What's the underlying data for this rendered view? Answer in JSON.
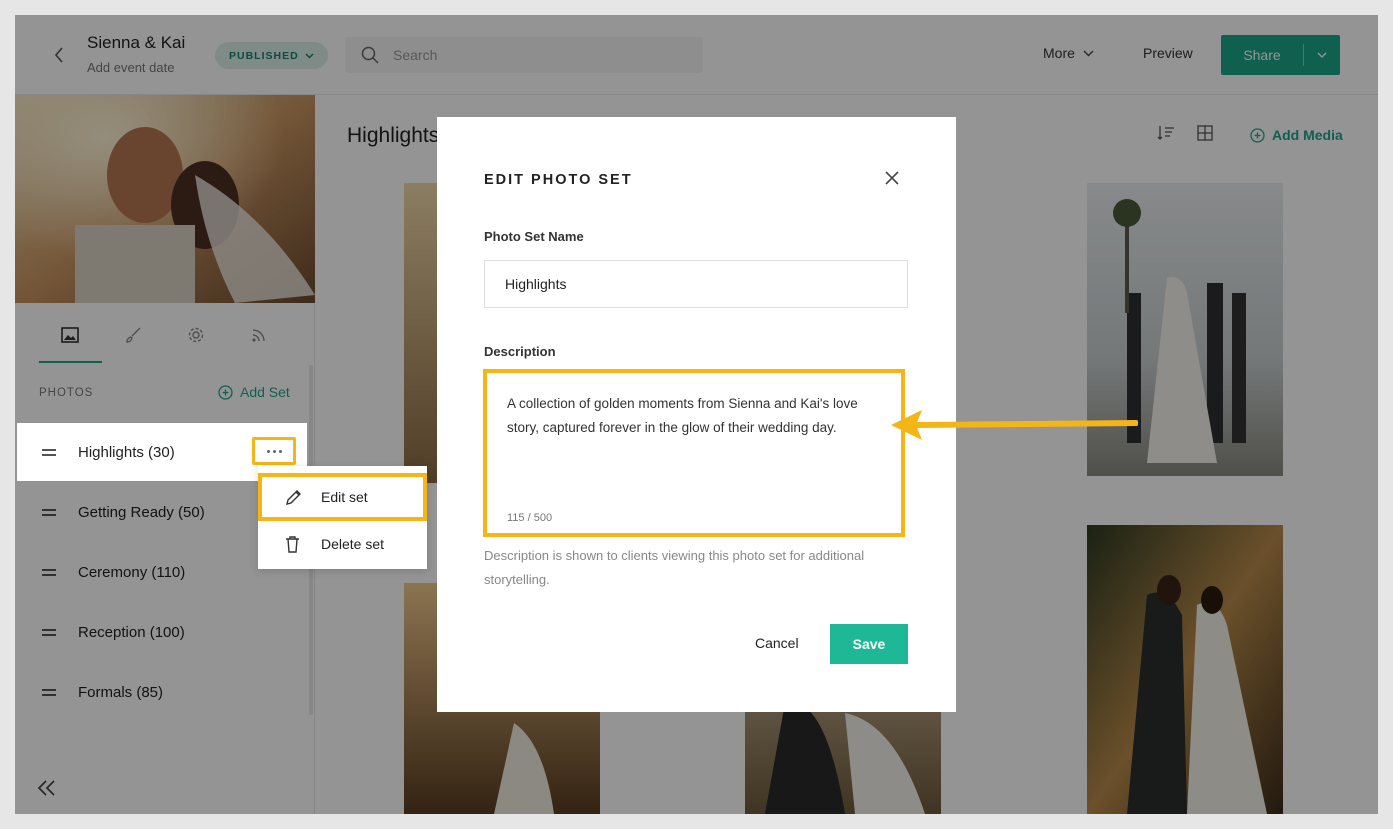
{
  "header": {
    "event_title": "Sienna & Kai",
    "event_date": "Add event date",
    "status": "PUBLISHED",
    "search_placeholder": "Search",
    "more_label": "More",
    "preview_label": "Preview",
    "share_label": "Share"
  },
  "sidebar": {
    "section_label": "PHOTOS",
    "add_set_label": "Add Set",
    "tabs": [
      "photos-tab",
      "design-tab",
      "settings-tab",
      "feed-tab"
    ],
    "sets": [
      {
        "name": "Highlights (30)"
      },
      {
        "name": "Getting Ready (50)"
      },
      {
        "name": "Ceremony (110)"
      },
      {
        "name": "Reception (100)"
      },
      {
        "name": "Formals (85)"
      }
    ]
  },
  "context_menu": {
    "edit_label": "Edit set",
    "delete_label": "Delete set"
  },
  "main": {
    "title": "Highlights",
    "add_media_label": "Add Media"
  },
  "modal": {
    "title": "EDIT PHOTO SET",
    "name_label": "Photo Set Name",
    "name_value": "Highlights",
    "description_label": "Description",
    "description_value": "A collection of golden moments from Sienna and Kai's love story, captured forever in the glow of their wedding day.",
    "char_count": "115 / 500",
    "help_text": "Description is shown to clients viewing this photo set for additional storytelling.",
    "cancel_label": "Cancel",
    "save_label": "Save"
  },
  "colors": {
    "accent": "#1aa689",
    "highlight": "#f4b617",
    "status_bg": "#d9efe8"
  }
}
